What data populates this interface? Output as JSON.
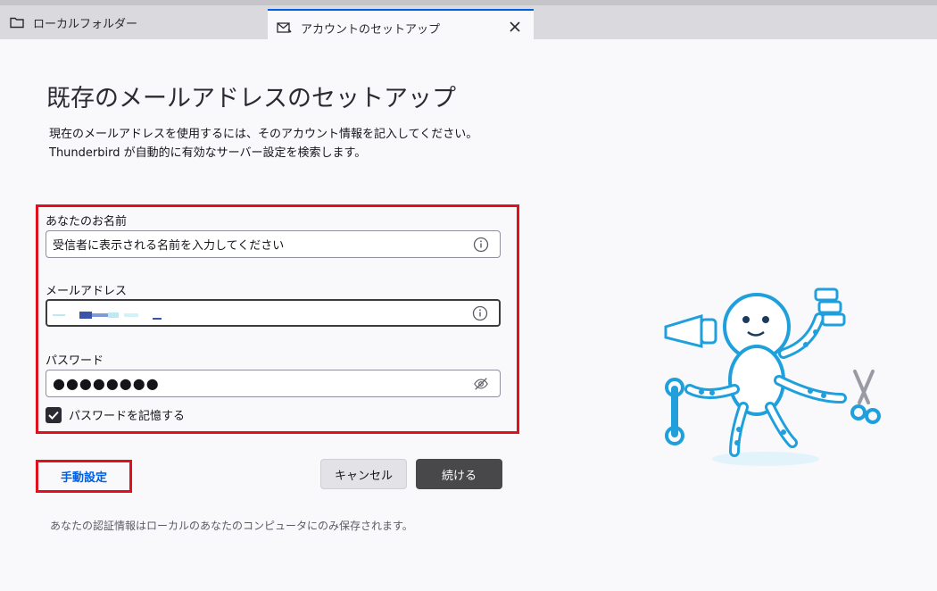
{
  "tabs": [
    {
      "label": "ローカルフォルダー",
      "icon": "folder-icon"
    },
    {
      "label": "アカウントのセットアップ",
      "icon": "mail-setup-icon",
      "close_glyph": "✕"
    }
  ],
  "page": {
    "title": "既存のメールアドレスのセットアップ",
    "description_line1": "現在のメールアドレスを使用するには、そのアカウント情報を記入してください。",
    "description_line2": "Thunderbird が自動的に有効なサーバー設定を検索します。"
  },
  "form": {
    "name_label": "あなたのお名前",
    "name_placeholder": "受信者に表示される名前を入力してください",
    "email_label": "メールアドレス",
    "email_value": "",
    "password_label": "パスワード",
    "password_value": "●●●●●●●●",
    "remember_label": "パスワードを記憶する",
    "remember_checked": true
  },
  "actions": {
    "manual_label": "手動設定",
    "cancel_label": "キャンセル",
    "continue_label": "続ける"
  },
  "footnote": "あなたの認証情報はローカルのあなたのコンピュータにのみ保存されます。",
  "colors": {
    "accent": "#0060df",
    "highlight_box": "#e0111c",
    "primary_button": "#48484b",
    "mascot": "#1fa0dc"
  }
}
